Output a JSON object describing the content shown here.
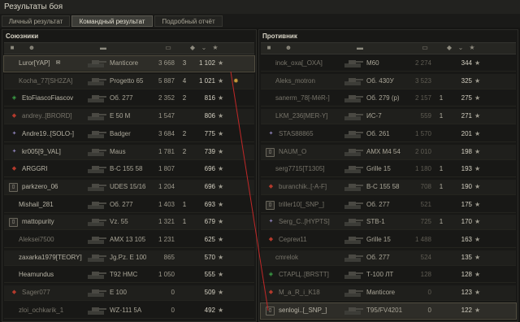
{
  "window": {
    "title": "Результаты боя"
  },
  "tabs": [
    {
      "label": "Личный результат",
      "active": false
    },
    {
      "label": "Командный результат",
      "active": true
    },
    {
      "label": "Подробный отчёт",
      "active": false
    }
  ],
  "columns": {
    "icons": [
      "flag-icon",
      "player-icon",
      "tank-icon",
      "damage-icon",
      "kills-icon",
      "sort-chevron-icon",
      "experience-star-icon"
    ]
  },
  "allies": {
    "title": "Союзники",
    "rows": [
      {
        "name": "Luror[YAP]",
        "tank": "Manticore",
        "damage": "3 668",
        "kills": "3",
        "xp": "1 102",
        "highlight": true,
        "badge": "chat"
      },
      {
        "name": "Kocha_77[SH2ZA]",
        "tank": "Progetto 65",
        "damage": "5 887",
        "kills": "4",
        "xp": "1 021",
        "dead": true,
        "medal": true
      },
      {
        "name": "EtoFiascoFiascov",
        "tank": "Об. 277",
        "damage": "2 352",
        "kills": "2",
        "xp": "816",
        "badge": "green"
      },
      {
        "name": "andrey..[BRORD]",
        "tank": "E 50 M",
        "damage": "1 547",
        "kills": "",
        "xp": "806",
        "dead": true,
        "badge": "red"
      },
      {
        "name": "Andre19..[SOLO-]",
        "tank": "Badger",
        "damage": "3 684",
        "kills": "2",
        "xp": "775",
        "badge": "emblem"
      },
      {
        "name": "kr005[9_VAL]",
        "tank": "Maus",
        "damage": "1 781",
        "kills": "2",
        "xp": "739",
        "badge": "emblem"
      },
      {
        "name": "ARGGRI",
        "tank": "B-C 155 58",
        "damage": "1 807",
        "kills": "",
        "xp": "696",
        "badge": "red"
      },
      {
        "name": "parkzero_06",
        "tank": "UDES 15/16",
        "damage": "1 204",
        "kills": "",
        "xp": "696",
        "badge": "clan"
      },
      {
        "name": "Mishail_281",
        "tank": "Об. 277",
        "damage": "1 403",
        "kills": "1",
        "xp": "693"
      },
      {
        "name": "mattopurity",
        "tank": "Vz. 55",
        "damage": "1 321",
        "kills": "1",
        "xp": "679",
        "badge": "clan2"
      },
      {
        "name": "Aleksei7500",
        "tank": "AMX 13 105",
        "damage": "1 231",
        "kills": "",
        "xp": "625",
        "dead": true
      },
      {
        "name": "zaxarka1979[TEORY]",
        "tank": "Jg.Pz. E 100",
        "damage": "865",
        "kills": "",
        "xp": "570"
      },
      {
        "name": "Heamundus",
        "tank": "T92 HMC",
        "damage": "1 050",
        "kills": "",
        "xp": "555"
      },
      {
        "name": "Sager077",
        "tank": "E 100",
        "damage": "0",
        "kills": "",
        "xp": "509",
        "dead": true,
        "badge": "red"
      },
      {
        "name": "zloi_ochkarik_1",
        "tank": "WZ-111 5A",
        "damage": "0",
        "kills": "",
        "xp": "492",
        "dead": true
      }
    ]
  },
  "enemies": {
    "title": "Противник",
    "rows": [
      {
        "name": "inok_oxa[_OXA]",
        "tank": "M60",
        "damage": "2 274",
        "kills": "",
        "xp": "344",
        "dead": true
      },
      {
        "name": "Aleks_motron",
        "tank": "Об. 430У",
        "damage": "3 523",
        "kills": "",
        "xp": "325",
        "dead": true
      },
      {
        "name": "sanerm_78[-MёR-]",
        "tank": "Об. 279 (р)",
        "damage": "2 157",
        "kills": "1",
        "xp": "275",
        "dead": true
      },
      {
        "name": "LKM_236[MER-Y]",
        "tank": "ИС-7",
        "damage": "559",
        "kills": "1",
        "xp": "271",
        "dead": true
      },
      {
        "name": "STAS88865",
        "tank": "Об. 261",
        "damage": "1 570",
        "kills": "",
        "xp": "201",
        "dead": true,
        "badge": "emblem"
      },
      {
        "name": "NAUM_O",
        "tank": "AMX M4 54",
        "damage": "2 010",
        "kills": "",
        "xp": "198",
        "dead": true,
        "badge": "clan"
      },
      {
        "name": "serg7715[T1305]",
        "tank": "Grille 15",
        "damage": "1 180",
        "kills": "1",
        "xp": "193",
        "dead": true
      },
      {
        "name": "buranchik..[-A-F]",
        "tank": "B-C 155 58",
        "damage": "708",
        "kills": "1",
        "xp": "190",
        "dead": true,
        "badge": "red"
      },
      {
        "name": "triller10[_SNP_]",
        "tank": "Об. 277",
        "damage": "521",
        "kills": "",
        "xp": "175",
        "dead": true,
        "badge": "clan"
      },
      {
        "name": "Serg_C..[HYPTS]",
        "tank": "STB-1",
        "damage": "725",
        "kills": "1",
        "xp": "170",
        "dead": true,
        "badge": "emblem"
      },
      {
        "name": "Сергеи11",
        "tank": "Grille 15",
        "damage": "1 488",
        "kills": "",
        "xp": "163",
        "dead": true,
        "badge": "red"
      },
      {
        "name": "cmrelok",
        "tank": "Об. 277",
        "damage": "524",
        "kills": "",
        "xp": "135",
        "dead": true
      },
      {
        "name": "СТАРЦ..[BRSTT]",
        "tank": "Т-100 ЛТ",
        "damage": "128",
        "kills": "",
        "xp": "128",
        "dead": true,
        "badge": "green"
      },
      {
        "name": "M_a_R_i_K18",
        "tank": "Manticore",
        "damage": "0",
        "kills": "",
        "xp": "123",
        "dead": true,
        "badge": "red"
      },
      {
        "name": "senlogi..[_SNP_]",
        "tank": "T95/FV4201",
        "damage": "0",
        "kills": "",
        "xp": "122",
        "highlight": true,
        "badge": "clan"
      }
    ]
  }
}
